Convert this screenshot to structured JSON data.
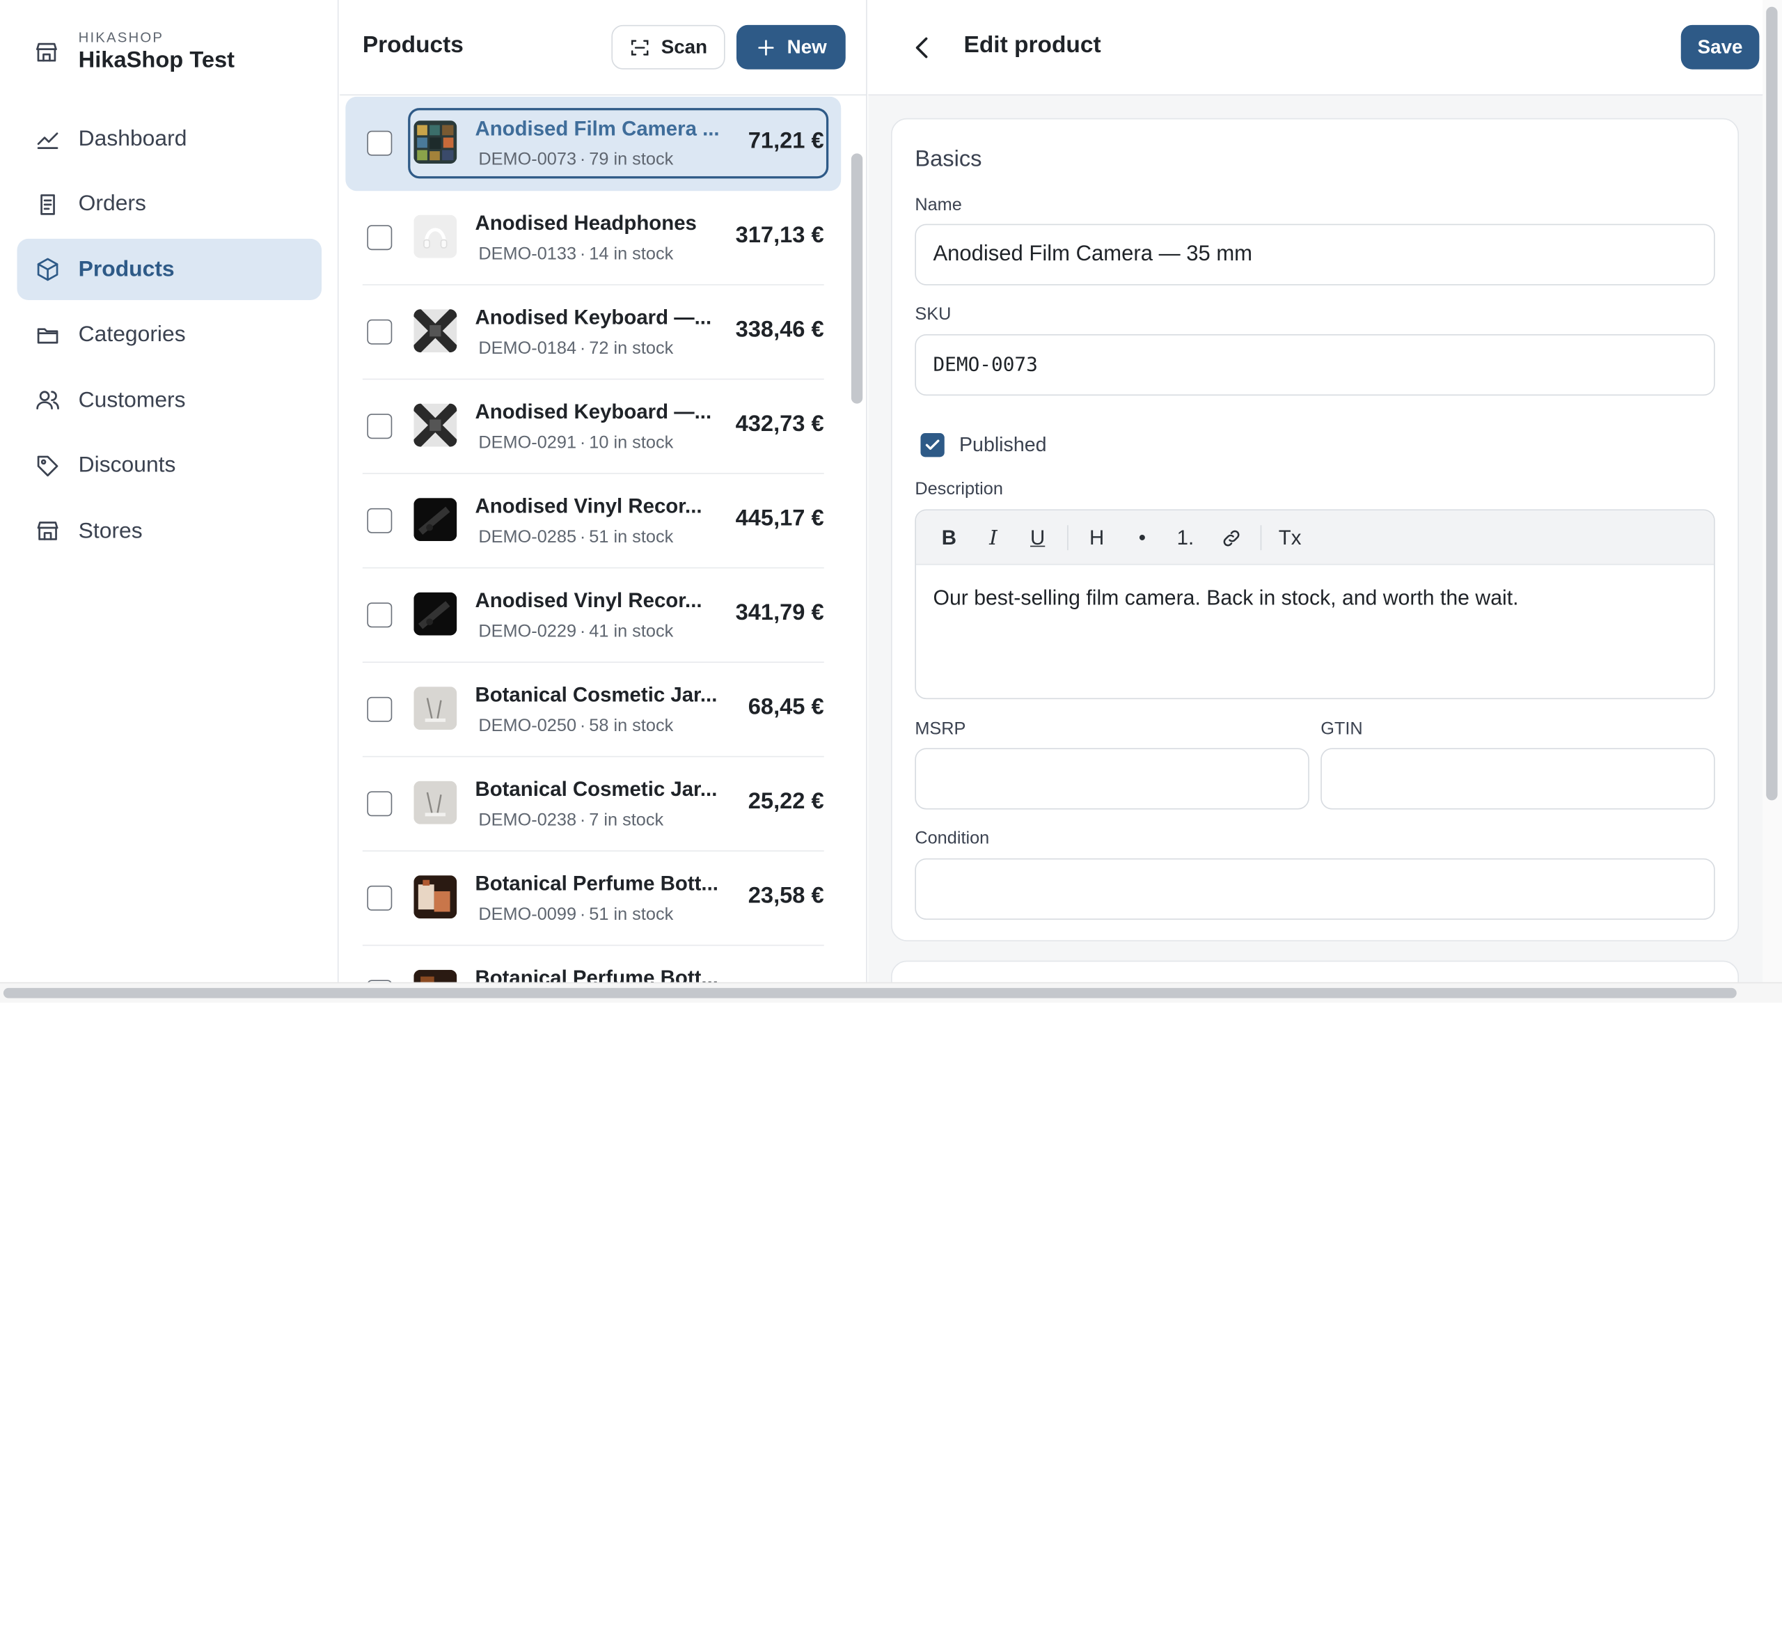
{
  "brand": {
    "small": "HIKASHOP",
    "name": "HikaShop Test"
  },
  "nav": [
    {
      "label": "Dashboard",
      "icon": "chart-line-icon"
    },
    {
      "label": "Orders",
      "icon": "receipt-icon"
    },
    {
      "label": "Products",
      "icon": "box-icon",
      "active": true
    },
    {
      "label": "Categories",
      "icon": "folder-icon"
    },
    {
      "label": "Customers",
      "icon": "users-icon"
    },
    {
      "label": "Discounts",
      "icon": "tag-icon"
    },
    {
      "label": "Stores",
      "icon": "store-icon"
    }
  ],
  "list": {
    "title": "Products",
    "scan_label": "Scan",
    "new_label": "New",
    "products": [
      {
        "name": "Anodised Film Camera ...",
        "sku": "DEMO-0073",
        "stock": "79 in stock",
        "price": "71,21 €",
        "selected": true,
        "thumb": "camera"
      },
      {
        "name": "Anodised Headphones",
        "sku": "DEMO-0133",
        "stock": "14 in stock",
        "price": "317,13 €",
        "thumb": "headphones"
      },
      {
        "name": "Anodised Keyboard —...",
        "sku": "DEMO-0184",
        "stock": "72 in stock",
        "price": "338,46 €",
        "thumb": "keyboard"
      },
      {
        "name": "Anodised Keyboard —...",
        "sku": "DEMO-0291",
        "stock": "10 in stock",
        "price": "432,73 €",
        "thumb": "keyboard"
      },
      {
        "name": "Anodised Vinyl Recor...",
        "sku": "DEMO-0285",
        "stock": "51 in stock",
        "price": "445,17 €",
        "thumb": "vinyl"
      },
      {
        "name": "Anodised Vinyl Recor...",
        "sku": "DEMO-0229",
        "stock": "41 in stock",
        "price": "341,79 €",
        "thumb": "vinyl"
      },
      {
        "name": "Botanical Cosmetic Jar...",
        "sku": "DEMO-0250",
        "stock": "58 in stock",
        "price": "68,45 €",
        "thumb": "jar"
      },
      {
        "name": "Botanical Cosmetic Jar...",
        "sku": "DEMO-0238",
        "stock": "7 in stock",
        "price": "25,22 €",
        "thumb": "jar"
      },
      {
        "name": "Botanical Perfume Bott...",
        "sku": "DEMO-0099",
        "stock": "51 in stock",
        "price": "23,58 €",
        "thumb": "perfume"
      },
      {
        "name": "Botanical Perfume Bott...",
        "sku": "",
        "stock": "",
        "price": "",
        "thumb": "perfume2"
      }
    ]
  },
  "edit": {
    "title": "Edit product",
    "save_label": "Save",
    "section_basics": "Basics",
    "name_label": "Name",
    "name_value": "Anodised Film Camera — 35 mm",
    "sku_label": "SKU",
    "sku_value": "DEMO-0073",
    "published_label": "Published",
    "description_label": "Description",
    "toolbar": {
      "bold": "B",
      "italic": "I",
      "underline": "U",
      "heading": "H",
      "bullet": "•",
      "ordered": "1.",
      "clear": "Tx"
    },
    "description_value": "Our best-selling film camera. Back in stock, and worth the wait.",
    "msrp_label": "MSRP",
    "msrp_value": "",
    "gtin_label": "GTIN",
    "gtin_value": "",
    "condition_label": "Condition",
    "condition_value": ""
  },
  "colors": {
    "accent": "#2e5a87",
    "active_bg": "#dce7f3"
  }
}
